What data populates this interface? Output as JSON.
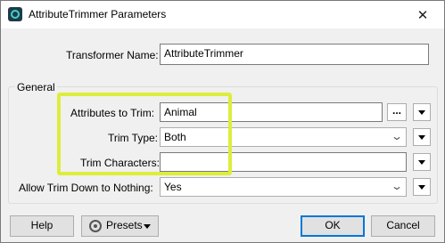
{
  "window": {
    "title": "AttributeTrimmer Parameters",
    "close_glyph": "✕"
  },
  "transformer": {
    "label": "Transformer Name:",
    "value": "AttributeTrimmer"
  },
  "general": {
    "title": "General",
    "attributes_to_trim": {
      "label": "Attributes to Trim:",
      "value": "Animal",
      "ellipsis": "..."
    },
    "trim_type": {
      "label": "Trim Type:",
      "value": "Both"
    },
    "trim_characters": {
      "label": "Trim Characters:",
      "value": ""
    },
    "allow_trim": {
      "label": "Allow Trim Down to Nothing:",
      "value": "Yes"
    }
  },
  "buttons": {
    "help": "Help",
    "presets": "Presets",
    "ok": "OK",
    "cancel": "Cancel"
  },
  "colors": {
    "highlight": "#dcee3b",
    "ok_border": "#0078d7"
  },
  "icons": {
    "app": "fme-app-icon",
    "presets": "gear-icon",
    "dropdown": "chevron-down-icon",
    "menu": "triangle-down-icon"
  }
}
